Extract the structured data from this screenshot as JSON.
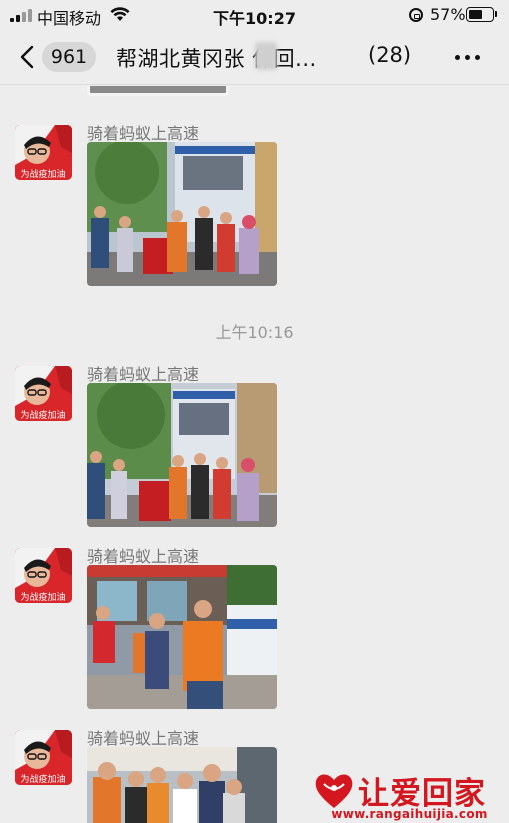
{
  "status_bar": {
    "carrier": "中国移动",
    "time": "下午10:27",
    "battery_percent_label": "57%",
    "battery_level": 0.57,
    "icons": [
      "signal-icon",
      "wifi-icon",
      "rotation-lock-icon",
      "battery-icon"
    ]
  },
  "nav": {
    "back_icon": "chevron-left-icon",
    "unread_count": "961",
    "title": "帮湖北黄冈张 保回...",
    "member_count": "(28)",
    "more_icon": "more-dots-icon"
  },
  "messages": [
    {
      "sender": "骑着蚂蚁上高速",
      "type": "image",
      "avatar_caption": "为战疫加油",
      "photo_scene": "group-banner-police-kiosk"
    },
    {
      "sender": "骑着蚂蚁上高速",
      "type": "image",
      "avatar_caption": "为战疫加油",
      "photo_scene": "group-banner-police-kiosk"
    },
    {
      "sender": "骑着蚂蚁上高速",
      "type": "image",
      "avatar_caption": "为战疫加油",
      "photo_scene": "street-police-van"
    },
    {
      "sender": "骑着蚂蚁上高速",
      "type": "image",
      "avatar_caption": "为战疫加油",
      "photo_scene": "crowd-station"
    }
  ],
  "time_divider": "上午10:16",
  "watermark": {
    "brand": "让爱回家",
    "url": "www.rangaihuijia.com",
    "brand_color": "#d4171f"
  },
  "colors": {
    "background": "#ededed",
    "avatar_red": "#d8262a"
  }
}
